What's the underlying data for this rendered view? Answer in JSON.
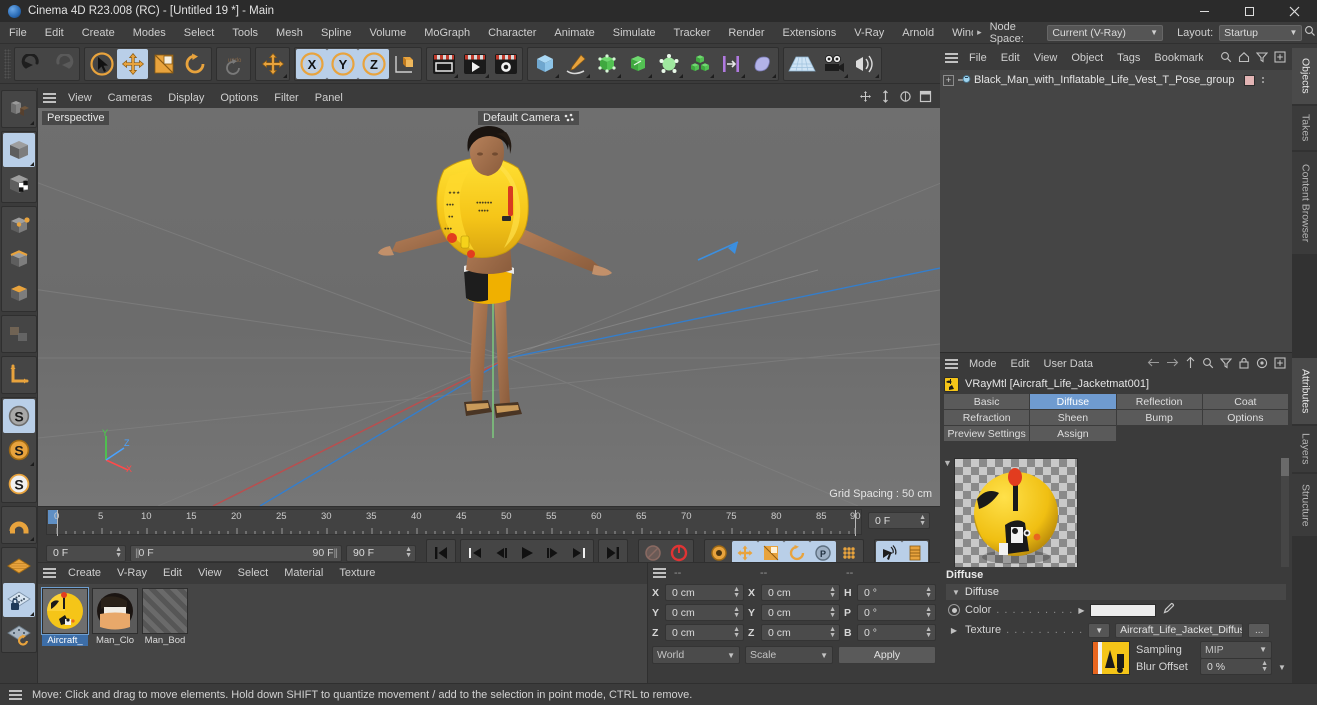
{
  "window": {
    "title": "Cinema 4D R23.008 (RC) - [Untitled 19 *] - Main",
    "logo_icon": "cinema4d-logo-icon",
    "minimize_label": "Minimize",
    "maximize_label": "Maximize",
    "close_label": "Close"
  },
  "menubar": {
    "items": [
      "File",
      "Edit",
      "Create",
      "Modes",
      "Select",
      "Tools",
      "Mesh",
      "Spline",
      "Volume",
      "MoGraph",
      "Character",
      "Animate",
      "Simulate",
      "Tracker",
      "Render",
      "Extensions",
      "V-Ray",
      "Arnold",
      "Wind"
    ],
    "overflow_arrow": "▸",
    "node_space_label": "Node Space:",
    "node_space_value": "Current (V-Ray)",
    "layout_label": "Layout:",
    "layout_value": "Startup",
    "search_icon": "search-icon"
  },
  "toolbar": {
    "groups": [
      {
        "buttons": [
          {
            "name": "undo-button",
            "icon": "undo-icon",
            "active": false,
            "corner": false
          },
          {
            "name": "redo-button",
            "icon": "redo-icon",
            "active": false,
            "corner": false
          }
        ]
      },
      {
        "buttons": [
          {
            "name": "select-tool-button",
            "icon": "cursor-select-icon",
            "active": false,
            "corner": true
          },
          {
            "name": "move-tool-button",
            "icon": "move-axis-icon",
            "active": true,
            "corner": false
          },
          {
            "name": "scale-tool-button",
            "icon": "scale-cube-icon",
            "active": false,
            "corner": false
          },
          {
            "name": "rotate-tool-button",
            "icon": "rotate-circle-icon",
            "active": false,
            "corner": false
          }
        ]
      },
      {
        "buttons": [
          {
            "name": "undo-view-button",
            "icon": "undo-view-icon",
            "active": false,
            "corner": false
          }
        ]
      },
      {
        "buttons": [
          {
            "name": "move-dup-button",
            "icon": "move-axis-icon",
            "active": false,
            "corner": true
          }
        ]
      },
      {
        "buttons": [
          {
            "name": "axis-x-button",
            "icon": "axis-x-icon",
            "active": true,
            "corner": false
          },
          {
            "name": "axis-y-button",
            "icon": "axis-y-icon",
            "active": true,
            "corner": false
          },
          {
            "name": "axis-z-button",
            "icon": "axis-z-icon",
            "active": true,
            "corner": false
          },
          {
            "name": "world-object-coord-button",
            "icon": "world-axis-cube-icon",
            "active": false,
            "corner": false
          }
        ]
      },
      {
        "buttons": [
          {
            "name": "render-view-button",
            "icon": "render-frame-icon",
            "active": false,
            "corner": true
          },
          {
            "name": "render-to-picture-viewer-button",
            "icon": "render-play-icon",
            "active": false,
            "corner": true
          },
          {
            "name": "render-settings-button",
            "icon": "render-gear-icon",
            "active": false,
            "corner": false
          }
        ]
      },
      {
        "buttons": [
          {
            "name": "add-cube-button",
            "icon": "cube-icon",
            "active": false,
            "corner": true
          },
          {
            "name": "add-spline-button",
            "icon": "pen-spline-icon",
            "active": false,
            "corner": true
          },
          {
            "name": "add-generator-button",
            "icon": "generator-icon",
            "active": false,
            "corner": true
          },
          {
            "name": "add-spline-generator-button",
            "icon": "green-cube-icon",
            "active": false,
            "corner": true
          },
          {
            "name": "add-deformer-button",
            "icon": "deformer-icon",
            "active": false,
            "corner": true
          },
          {
            "name": "add-array-button",
            "icon": "array-cubes-icon",
            "active": false,
            "corner": true
          },
          {
            "name": "add-scene-button",
            "icon": "scene-bar-icon",
            "active": false,
            "corner": true
          },
          {
            "name": "add-field-button",
            "icon": "field-blob-icon",
            "active": false,
            "corner": true
          }
        ]
      },
      {
        "buttons": [
          {
            "name": "add-floor-button",
            "icon": "floor-grid-icon",
            "active": false,
            "corner": false
          },
          {
            "name": "add-camera-button",
            "icon": "camera-icon",
            "active": false,
            "corner": true
          },
          {
            "name": "add-light-button",
            "icon": "light-icon",
            "active": false,
            "corner": true
          }
        ]
      }
    ]
  },
  "left_toolbar": {
    "groups": [
      {
        "buttons": [
          {
            "name": "make-editable-button",
            "icon": "make-editable-icon",
            "active": false,
            "corner": true
          }
        ]
      },
      {
        "buttons": [
          {
            "name": "model-mode-button",
            "icon": "model-cube-icon",
            "active": true,
            "corner": true
          },
          {
            "name": "texture-mode-button",
            "icon": "texture-cube-icon",
            "active": false,
            "corner": false
          }
        ]
      },
      {
        "buttons": [
          {
            "name": "points-mode-button",
            "icon": "points-cube-icon",
            "active": false,
            "corner": false
          },
          {
            "name": "edges-mode-button",
            "icon": "edges-cube-icon",
            "active": false,
            "corner": false
          },
          {
            "name": "polygons-mode-button",
            "icon": "polygons-cube-icon",
            "active": false,
            "corner": false
          }
        ]
      },
      {
        "buttons": [
          {
            "name": "uv-mode-button",
            "icon": "uv-mode-icon",
            "active": false,
            "corner": false
          }
        ]
      },
      {
        "buttons": [
          {
            "name": "axis-modify-button",
            "icon": "axis-l-icon",
            "active": false,
            "corner": false
          }
        ]
      },
      {
        "buttons": [
          {
            "name": "snap-disabled-button",
            "icon": "snap-s-grey-icon",
            "active": true,
            "corner": false
          },
          {
            "name": "snap-enabled-button",
            "icon": "snap-s-orange-icon",
            "active": false,
            "corner": true
          },
          {
            "name": "snap-quantize-button",
            "icon": "snap-s-white-icon",
            "active": false,
            "corner": false
          }
        ]
      },
      {
        "buttons": [
          {
            "name": "magnet-tool-button",
            "icon": "magnet-icon",
            "active": false,
            "corner": true
          }
        ]
      },
      {
        "buttons": [
          {
            "name": "workplane-button",
            "icon": "workplane-orange-icon",
            "active": false,
            "corner": false
          },
          {
            "name": "lock-workplane-button",
            "icon": "workplane-lock-icon",
            "active": true,
            "corner": true
          },
          {
            "name": "planar-workplane-button",
            "icon": "workplane-rotate-icon",
            "active": false,
            "corner": false
          }
        ]
      }
    ]
  },
  "viewport": {
    "menu_items": [
      "View",
      "Cameras",
      "Display",
      "Options",
      "Filter",
      "Panel"
    ],
    "view_label": "Perspective",
    "camera_label": "Default Camera",
    "grid_spacing": "Grid Spacing : 50 cm",
    "corner_icons": [
      "pan-view-icon",
      "zoom-view-icon",
      "rotate-view-icon",
      "maximize-view-icon"
    ],
    "axis_gizmo": {
      "y_label": "Y",
      "z_label": "Z",
      "x_label": "X",
      "y_color": "#46d246",
      "z_color": "#4aa3ff",
      "x_color": "#ff4a4a"
    }
  },
  "timeline": {
    "ticks": [
      "0",
      "5",
      "10",
      "15",
      "20",
      "25",
      "30",
      "35",
      "40",
      "45",
      "50",
      "55",
      "60",
      "65",
      "70",
      "75",
      "80",
      "85",
      "90"
    ],
    "current_frame_field": "0 F",
    "start_frame_field": "0 F",
    "preview_min": "0 F",
    "preview_max": "90 F",
    "end_frame_field": "90 F",
    "transport": [
      {
        "name": "go-to-start-button",
        "icon": "go-to-start-icon"
      },
      {
        "name": "previous-key-button",
        "icon": "prev-key-icon"
      },
      {
        "name": "step-back-button",
        "icon": "step-back-icon"
      },
      {
        "name": "play-button",
        "icon": "play-icon"
      },
      {
        "name": "step-forward-button",
        "icon": "step-forward-icon"
      },
      {
        "name": "next-key-button",
        "icon": "next-key-icon"
      },
      {
        "name": "go-to-end-button",
        "icon": "go-to-end-icon"
      }
    ],
    "record_group": [
      {
        "name": "record-active-objects-button",
        "icon": "record-grey-icon",
        "active": false
      },
      {
        "name": "autokeying-button",
        "icon": "autokey-red-icon",
        "active": false
      }
    ],
    "key_group": [
      {
        "name": "keyframe-selection-button",
        "icon": "key-gear-icon",
        "active": false
      },
      {
        "name": "key-position-button",
        "icon": "key-move-icon",
        "active": true
      },
      {
        "name": "key-scale-button",
        "icon": "key-scale-icon",
        "active": true
      },
      {
        "name": "key-rotation-button",
        "icon": "key-rotate-icon",
        "active": true
      },
      {
        "name": "key-parameter-button",
        "icon": "key-param-icon",
        "active": true
      },
      {
        "name": "key-point-level-button",
        "icon": "key-pla-icon",
        "active": false
      }
    ],
    "right_group": [
      {
        "name": "sound-button",
        "icon": "sound-icon",
        "active": true
      },
      {
        "name": "timeline-layout-button",
        "icon": "timeline-icon",
        "active": true
      }
    ]
  },
  "material_manager": {
    "menu_items": [
      "Create",
      "V-Ray",
      "Edit",
      "View",
      "Select",
      "Material",
      "Texture"
    ],
    "materials": [
      {
        "name": "Aircraft_",
        "selected": true,
        "kind": "lifejacket-thumb"
      },
      {
        "name": "Man_Clo",
        "selected": false,
        "kind": "cloth-thumb"
      },
      {
        "name": "Man_Bod",
        "selected": false,
        "kind": "placeholder-thumb"
      }
    ]
  },
  "coordinates": {
    "headers": [
      "--",
      "--",
      "--"
    ],
    "rows": [
      {
        "a_axis": "X",
        "a_value": "0 cm",
        "b_axis": "X",
        "b_value": "0 cm",
        "c_axis": "H",
        "c_value": "0 °"
      },
      {
        "a_axis": "Y",
        "a_value": "0 cm",
        "b_axis": "Y",
        "b_value": "0 cm",
        "c_axis": "P",
        "c_value": "0 °"
      },
      {
        "a_axis": "Z",
        "a_value": "0 cm",
        "b_axis": "Z",
        "b_value": "0 cm",
        "c_axis": "B",
        "c_value": "0 °"
      }
    ],
    "space_value": "World",
    "mode_value": "Scale",
    "apply_label": "Apply"
  },
  "object_manager": {
    "menu_items": [
      "File",
      "Edit",
      "View",
      "Object",
      "Tags",
      "Bookmarks"
    ],
    "tools": [
      "search-icon",
      "home-icon",
      "filter-icon",
      "plus-icon"
    ],
    "objects": [
      {
        "name": "Black_Man_with_Inflatable_Life_Vest_T_Pose_group",
        "expander": "+",
        "icon": "null-object-icon"
      }
    ]
  },
  "attributes": {
    "menu_items": [
      "Mode",
      "Edit",
      "User Data"
    ],
    "tools": [
      "back-arrow-icon",
      "forward-arrow-icon",
      "up-arrow-icon",
      "search-icon",
      "filter-icon",
      "lock-icon",
      "target-icon",
      "plus-icon"
    ],
    "object_title": "VRayMtl [Aircraft_Life_Jacketmat001]",
    "tabs": [
      {
        "label": "Basic",
        "active": false
      },
      {
        "label": "Diffuse",
        "active": true
      },
      {
        "label": "Reflection",
        "active": false
      },
      {
        "label": "Coat",
        "active": false
      },
      {
        "label": "Refraction",
        "active": false
      },
      {
        "label": "Sheen",
        "active": false
      },
      {
        "label": "Bump",
        "active": false
      },
      {
        "label": "Options",
        "active": false
      },
      {
        "label": "Preview Settings",
        "active": false
      },
      {
        "label": "Assign",
        "active": false
      }
    ]
  },
  "diffuse_panel": {
    "section_title": "Diffuse",
    "group_title": "Diffuse",
    "color_label": "Color",
    "color_dots": ". . . . . . . . . .",
    "color_value": "#ededed",
    "eyedropper_icon": "eyedropper-icon",
    "texture_label": "Texture",
    "texture_dots": ". . . . . . . . . .",
    "texture_value": "Aircraft_Life_Jacket_Diffuse.",
    "browse_label": "...",
    "sampling_label": "Sampling",
    "sampling_value": "MIP",
    "blur_offset_label": "Blur Offset",
    "blur_offset_value": "0 %"
  },
  "right_tabs": {
    "top": [
      {
        "label": "Objects",
        "active": true
      },
      {
        "label": "Takes",
        "active": false
      },
      {
        "label": "Content Browser",
        "active": false
      }
    ],
    "bottom": [
      {
        "label": "Attributes",
        "active": true
      },
      {
        "label": "Layers",
        "active": false
      },
      {
        "label": "Structure",
        "active": false
      }
    ]
  },
  "statusbar": {
    "message": "Move: Click and drag to move elements. Hold down SHIFT to quantize movement / add to the selection in point mode, CTRL to remove."
  }
}
